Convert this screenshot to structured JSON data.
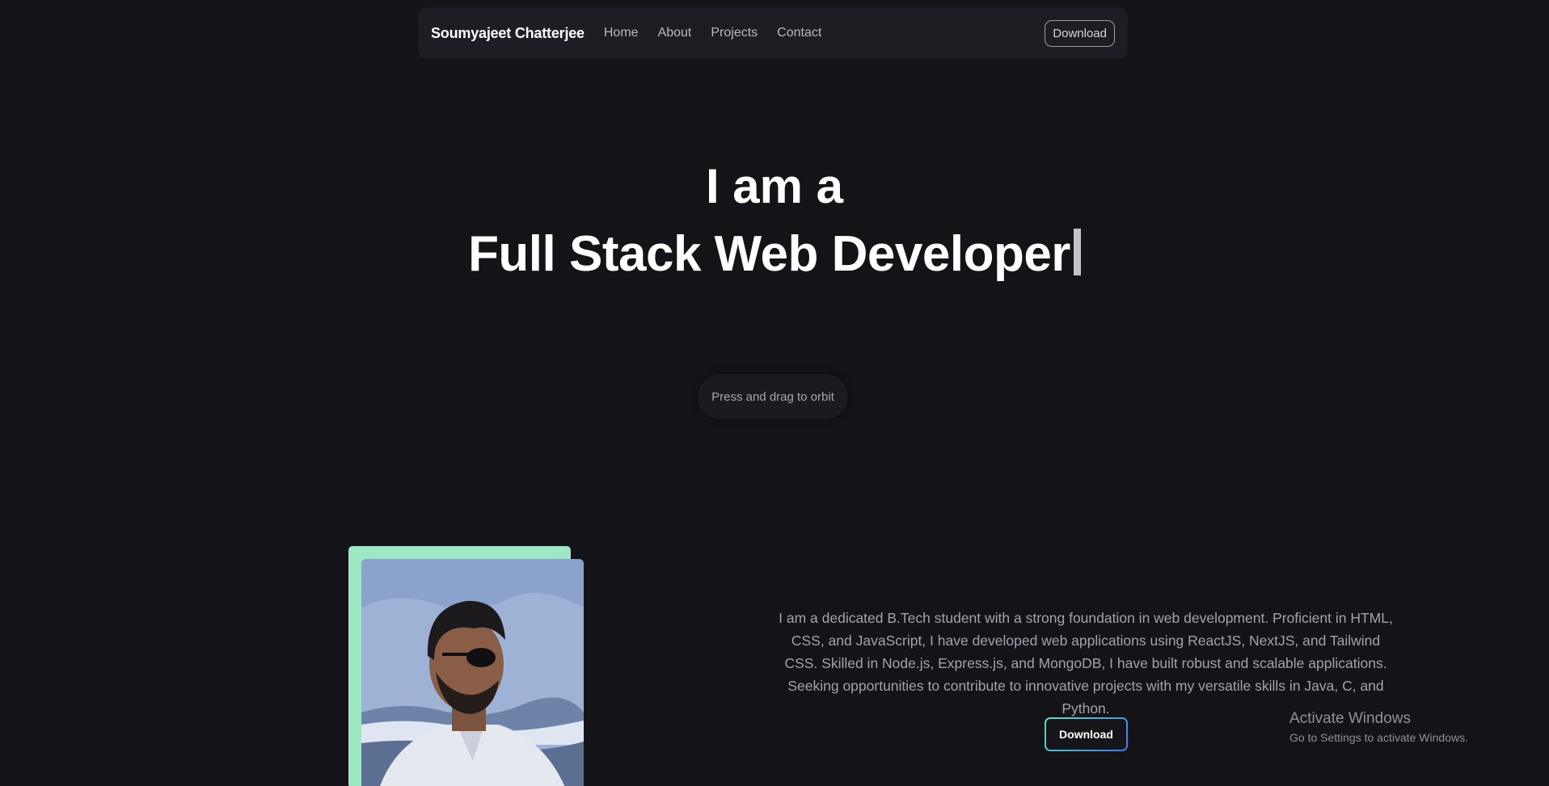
{
  "nav": {
    "brand": "Soumyajeet Chatterjee",
    "links": [
      "Home",
      "About",
      "Projects",
      "Contact"
    ],
    "download_label": "Download"
  },
  "hero": {
    "line1": "I am a",
    "line2": "Full Stack Web Developer"
  },
  "orbit_hint": "Press and drag to orbit",
  "about": {
    "text": "I am a dedicated B.Tech student with a strong foundation in web development. Proficient in HTML, CSS, and JavaScript, I have developed web applications using ReactJS, NextJS, and Tailwind CSS. Skilled in Node.js, Express.js, and MongoDB, I have built robust and scalable applications. Seeking opportunities to contribute to innovative projects with my versatile skills in Java, C, and Python.",
    "download_label": "Download"
  },
  "watermark": {
    "title": "Activate Windows",
    "subtitle": "Go to Settings to activate Windows."
  },
  "colors": {
    "background": "#141418",
    "navbar": "#1d1d24",
    "photo_accent": "#9de8c2",
    "button_gradient_start": "#5be0c0",
    "button_gradient_end": "#3a7bf0"
  }
}
